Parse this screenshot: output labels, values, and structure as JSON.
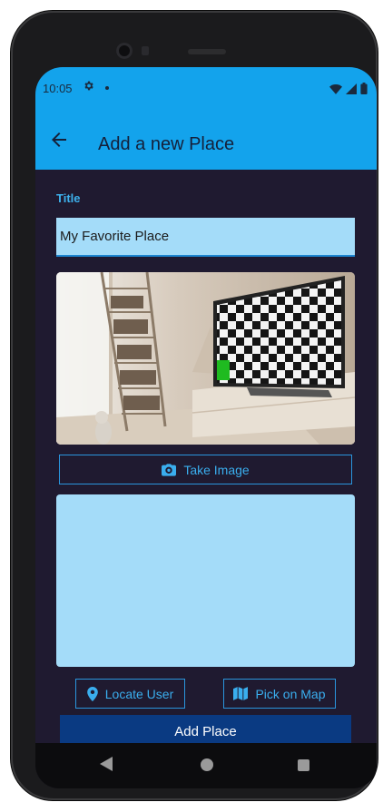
{
  "status_bar": {
    "time": "10:05",
    "icons": [
      "gear-icon",
      "notification-dot",
      "wifi-icon",
      "signal-icon",
      "battery-icon"
    ]
  },
  "app_bar": {
    "title": "Add a new Place",
    "back_icon": "arrow-back-icon"
  },
  "form": {
    "title_label": "Title",
    "title_value": "My Favorite Place",
    "take_image_label": "Take Image",
    "locate_user_label": "Locate User",
    "pick_on_map_label": "Pick on Map",
    "add_place_label": "Add Place"
  },
  "colors": {
    "primary": "#13a3ec",
    "background": "#1f1a30",
    "input_fill": "#a4dcf9",
    "accent_text": "#3aaeee",
    "submit_button": "#0a3a82"
  }
}
